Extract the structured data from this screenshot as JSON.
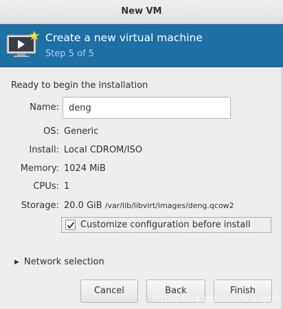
{
  "window": {
    "title": "New VM"
  },
  "banner": {
    "heading": "Create a new virtual machine",
    "step": "Step 5 of 5",
    "icon": "vm-monitor-icon"
  },
  "summary": {
    "ready_text": "Ready to begin the installation",
    "name_label": "Name:",
    "name_value": "deng",
    "os_label": "OS:",
    "os_value": "Generic",
    "install_label": "Install:",
    "install_value": "Local CDROM/ISO",
    "memory_label": "Memory:",
    "memory_value": "1024 MiB",
    "cpus_label": "CPUs:",
    "cpus_value": "1",
    "storage_label": "Storage:",
    "storage_size": "20.0 GiB",
    "storage_path": "/var/lib/libvirt/images/deng.qcow2"
  },
  "customize": {
    "label": "Customize configuration before install",
    "checked": true
  },
  "network": {
    "label": "Network selection",
    "expanded": false
  },
  "buttons": {
    "cancel": "Cancel",
    "back": "Back",
    "finish": "Finish"
  },
  "watermark": "https://blog.csdn.net/Shangerh",
  "colors": {
    "banner_bg": "#1d6fa6",
    "step_text": "#a9d6f4"
  }
}
